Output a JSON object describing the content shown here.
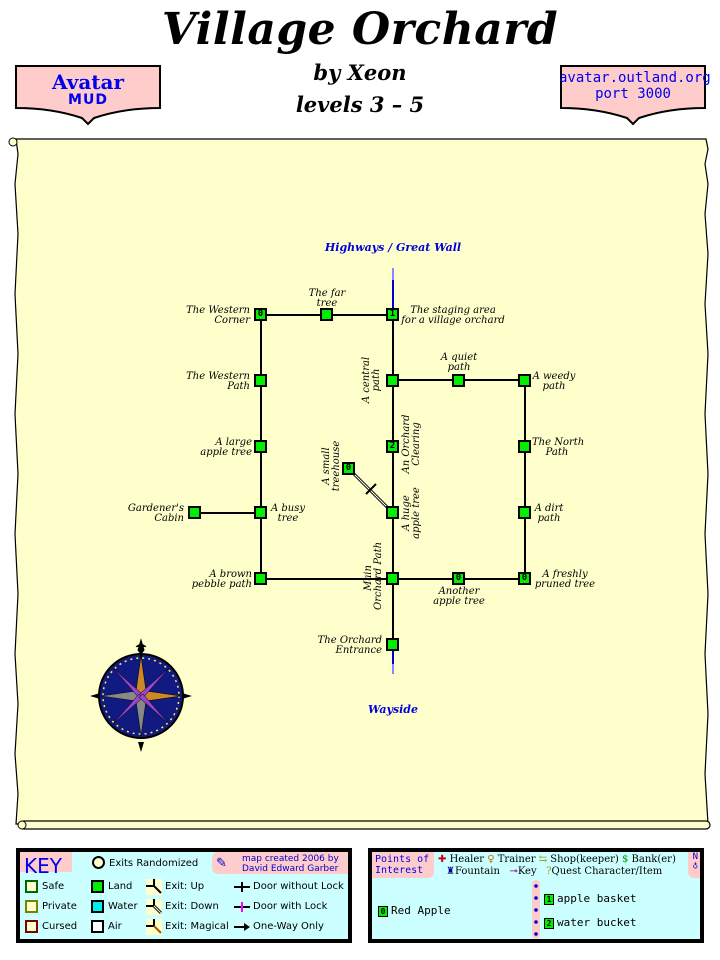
{
  "header": {
    "title": "Village Orchard",
    "byline": "by Xeon",
    "levels": "levels 3 – 5",
    "left_sign": {
      "line1": "Avatar",
      "line2": "MUD"
    },
    "right_sign": {
      "line1": "avatar.outland.org",
      "line2": "port 3000"
    }
  },
  "map": {
    "exits": {
      "north": "Highways / Great Wall",
      "south": "Wayside"
    },
    "rooms": [
      {
        "id": "western-corner",
        "label_lines": [
          "The Western",
          "Corner"
        ],
        "poi": "0"
      },
      {
        "id": "far-tree",
        "label_lines": [
          "The far",
          "tree"
        ],
        "poi": ""
      },
      {
        "id": "staging-area",
        "label_lines": [
          "The staging area",
          "for a village orchard"
        ],
        "poi": "1"
      },
      {
        "id": "western-path",
        "label_lines": [
          "The Western",
          "Path"
        ],
        "poi": ""
      },
      {
        "id": "central-path",
        "label_lines": [
          "A central",
          "path"
        ],
        "poi": ""
      },
      {
        "id": "quiet-path",
        "label_lines": [
          "A quiet",
          "path"
        ],
        "poi": ""
      },
      {
        "id": "weedy-path",
        "label_lines": [
          "A weedy",
          "path"
        ],
        "poi": ""
      },
      {
        "id": "large-apple-tree",
        "label_lines": [
          "A large",
          "apple tree"
        ],
        "poi": ""
      },
      {
        "id": "orchard-clearing",
        "label_lines": [
          "An Orchard",
          "Clearing"
        ],
        "poi": "2"
      },
      {
        "id": "north-path",
        "label_lines": [
          "The North",
          "Path"
        ],
        "poi": ""
      },
      {
        "id": "small-treehouse",
        "label_lines": [
          "A small",
          "treehouse"
        ],
        "poi": "0"
      },
      {
        "id": "gardeners-cabin",
        "label_lines": [
          "Gardener's",
          "Cabin"
        ],
        "poi": ""
      },
      {
        "id": "busy-tree",
        "label_lines": [
          "A busy",
          "tree"
        ],
        "poi": ""
      },
      {
        "id": "huge-apple-tree",
        "label_lines": [
          "A huge",
          "apple tree"
        ],
        "poi": ""
      },
      {
        "id": "dirt-path",
        "label_lines": [
          "A dirt",
          "path"
        ],
        "poi": ""
      },
      {
        "id": "brown-pebble-path",
        "label_lines": [
          "A brown",
          "pebble path"
        ],
        "poi": ""
      },
      {
        "id": "main-orchard-path",
        "label_lines": [
          "Main",
          "Orchard Path"
        ],
        "poi": ""
      },
      {
        "id": "another-apple-tree",
        "label_lines": [
          "Another",
          "apple tree"
        ],
        "poi": "0"
      },
      {
        "id": "freshly-pruned-tree",
        "label_lines": [
          "A freshly",
          "pruned tree"
        ],
        "poi": "0"
      },
      {
        "id": "orchard-entrance",
        "label_lines": [
          "The Orchard",
          "Entrance"
        ],
        "poi": ""
      }
    ]
  },
  "key": {
    "title": "KEY",
    "exits_randomized": "Exits Randomized",
    "credit_line1": "map created 2006 by",
    "credit_line2": "David Edward Garber",
    "zones": [
      "Safe",
      "Private",
      "Cursed"
    ],
    "terrain": [
      "Land",
      "Water",
      "Air"
    ],
    "exit_types": [
      "Exit: Up",
      "Exit: Down",
      "Exit: Magical"
    ],
    "doors": [
      "Door without Lock",
      "Door with Lock",
      "One-Way Only"
    ],
    "colors": {
      "safe": "#006600",
      "private": "#808000",
      "cursed": "#800000",
      "land": "#00ee00",
      "water": "#00eeee",
      "air": "#ffffff",
      "lock": "#ff00ff"
    }
  },
  "poi": {
    "title_line1": "Points of",
    "title_line2": "Interest",
    "legend_row1": [
      "Healer",
      "Trainer",
      "Shop(keeper)",
      "Bank(er)"
    ],
    "legend_row2": [
      "Fountain",
      "Key",
      "Quest Character/Item"
    ],
    "compass": "N",
    "items_left": [
      {
        "num": "0",
        "name": "Red Apple"
      }
    ],
    "items_right": [
      {
        "num": "1",
        "name": "apple basket"
      },
      {
        "num": "2",
        "name": "water bucket"
      }
    ]
  },
  "colors": {
    "parchment": "#ffffcc",
    "sign_fill": "#ffcccc",
    "legend_bg": "#ccffff",
    "room_fill": "#00ee00",
    "exit_text": "#0000dd"
  }
}
